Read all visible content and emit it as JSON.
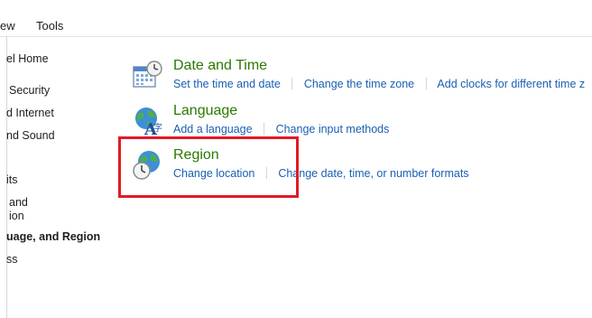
{
  "menubar": {
    "items": [
      "ew",
      "Tools"
    ]
  },
  "sidebar": {
    "items": [
      {
        "label": "el Home"
      },
      {
        "label": "Security"
      },
      {
        "label": "d Internet"
      },
      {
        "label": "nd Sound"
      },
      {
        "label": "its"
      },
      {
        "label": "and"
      },
      {
        "label": "ion"
      },
      {
        "label": "uage, and Region"
      },
      {
        "label": "ss"
      }
    ]
  },
  "categories": [
    {
      "title": "Date and Time",
      "icon": "calendar-clock-icon",
      "links": [
        "Set the time and date",
        "Change the time zone",
        "Add clocks for different time z"
      ]
    },
    {
      "title": "Language",
      "icon": "language-globe-icon",
      "links": [
        "Add a language",
        "Change input methods"
      ]
    },
    {
      "title": "Region",
      "icon": "region-globe-clock-icon",
      "links": [
        "Change location",
        "Change date, time, or number formats"
      ]
    }
  ],
  "colors": {
    "category_title": "#2a7a00",
    "link": "#1a5fb4",
    "highlight_border": "#e01b24"
  }
}
